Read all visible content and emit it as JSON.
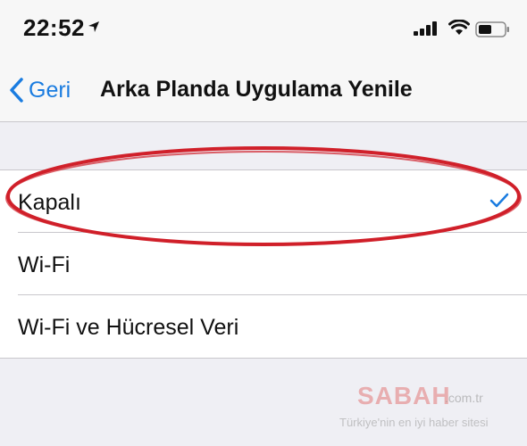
{
  "status_bar": {
    "time": "22:52",
    "icons": [
      "location-arrow-icon",
      "cellular-signal-icon",
      "wifi-icon",
      "battery-icon"
    ]
  },
  "nav": {
    "back_label": "Geri",
    "title": "Arka Planda Uygulama Yenile"
  },
  "options": [
    {
      "label": "Kapalı",
      "selected": true
    },
    {
      "label": "Wi-Fi",
      "selected": false
    },
    {
      "label": "Wi-Fi ve Hücresel Veri",
      "selected": false
    }
  ],
  "watermark": {
    "brand": "SABAH",
    "domain": ".com.tr",
    "tagline": "Türkiye'nin en iyi haber sitesi"
  },
  "colors": {
    "accent": "#1a7ce0",
    "highlight_ellipse": "#d0202a",
    "background": "#efeff4"
  }
}
